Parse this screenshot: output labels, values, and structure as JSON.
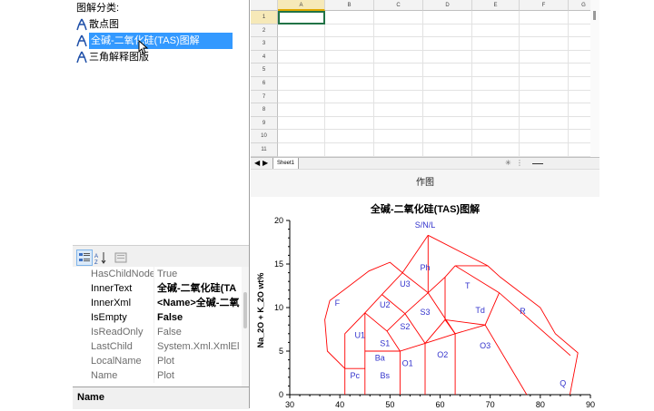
{
  "tree": {
    "header": "图解分类:",
    "items": [
      {
        "label": "散点图",
        "selected": false
      },
      {
        "label": "全碱-二氧化硅(TAS)图解",
        "selected": true
      },
      {
        "label": "三角解释图版",
        "selected": false
      }
    ]
  },
  "prop_toolbar": {
    "buttons": [
      "categorized-icon",
      "alphabetical-icon",
      "property-pages-icon"
    ]
  },
  "properties": [
    {
      "name": "HasChildNode",
      "value": "True",
      "bold": false
    },
    {
      "name": "InnerText",
      "value": "全碱-二氧化硅(TA",
      "bold": true
    },
    {
      "name": "InnerXml",
      "value": "<Name>全碱-二氧",
      "bold": true
    },
    {
      "name": "IsEmpty",
      "value": "False",
      "bold": true
    },
    {
      "name": "IsReadOnly",
      "value": "False",
      "bold": false
    },
    {
      "name": "LastChild",
      "value": "System.Xml.XmlEl",
      "bold": false
    },
    {
      "name": "LocalName",
      "value": "Plot",
      "bold": false
    },
    {
      "name": "Name",
      "value": "Plot",
      "bold": false
    }
  ],
  "prop_description": "Name",
  "spreadsheet": {
    "columns": [
      "A",
      "B",
      "C",
      "D",
      "E",
      "F",
      "G"
    ],
    "rows": [
      "1",
      "2",
      "3",
      "4",
      "5",
      "6",
      "7",
      "8",
      "9",
      "10",
      "11"
    ],
    "active_cell": "A1",
    "sheet_tab": "Sheet1"
  },
  "plot_button": "作图",
  "chart_data": {
    "type": "scatter",
    "title": "全碱-二氧化硅(TAS)图解",
    "xlabel": "",
    "ylabel": "Na_2O + K_2O wt%",
    "xlim": [
      30,
      90
    ],
    "ylim": [
      0,
      20
    ],
    "xticks": [
      "30",
      "40",
      "50",
      "60",
      "70",
      "80",
      "90"
    ],
    "yticks": [
      "0",
      "5",
      "10",
      "15",
      "20"
    ],
    "line_color": "#ff0000",
    "label_color": "#3333cc",
    "field_labels": [
      {
        "text": "S/N/L",
        "x": 57,
        "y": 19.5
      },
      {
        "text": "Ph",
        "x": 57,
        "y": 14.6
      },
      {
        "text": "T",
        "x": 65.5,
        "y": 12.5
      },
      {
        "text": "U3",
        "x": 53,
        "y": 12.7
      },
      {
        "text": "F",
        "x": 39.5,
        "y": 10.5
      },
      {
        "text": "U2",
        "x": 49,
        "y": 10.3
      },
      {
        "text": "Td",
        "x": 68,
        "y": 9.7
      },
      {
        "text": "R",
        "x": 76.5,
        "y": 9.6
      },
      {
        "text": "S3",
        "x": 57,
        "y": 9.5
      },
      {
        "text": "S2",
        "x": 53,
        "y": 7.8
      },
      {
        "text": "U1",
        "x": 44,
        "y": 6.8
      },
      {
        "text": "S1",
        "x": 49,
        "y": 5.9
      },
      {
        "text": "O3",
        "x": 69,
        "y": 5.6
      },
      {
        "text": "O2",
        "x": 60.5,
        "y": 4.6
      },
      {
        "text": "Ba",
        "x": 48,
        "y": 4.2
      },
      {
        "text": "O1",
        "x": 53.5,
        "y": 3.6
      },
      {
        "text": "Pc",
        "x": 43,
        "y": 2.2
      },
      {
        "text": "Bs",
        "x": 49,
        "y": 2.2
      },
      {
        "text": "Q",
        "x": 84.5,
        "y": 1.3
      }
    ]
  }
}
